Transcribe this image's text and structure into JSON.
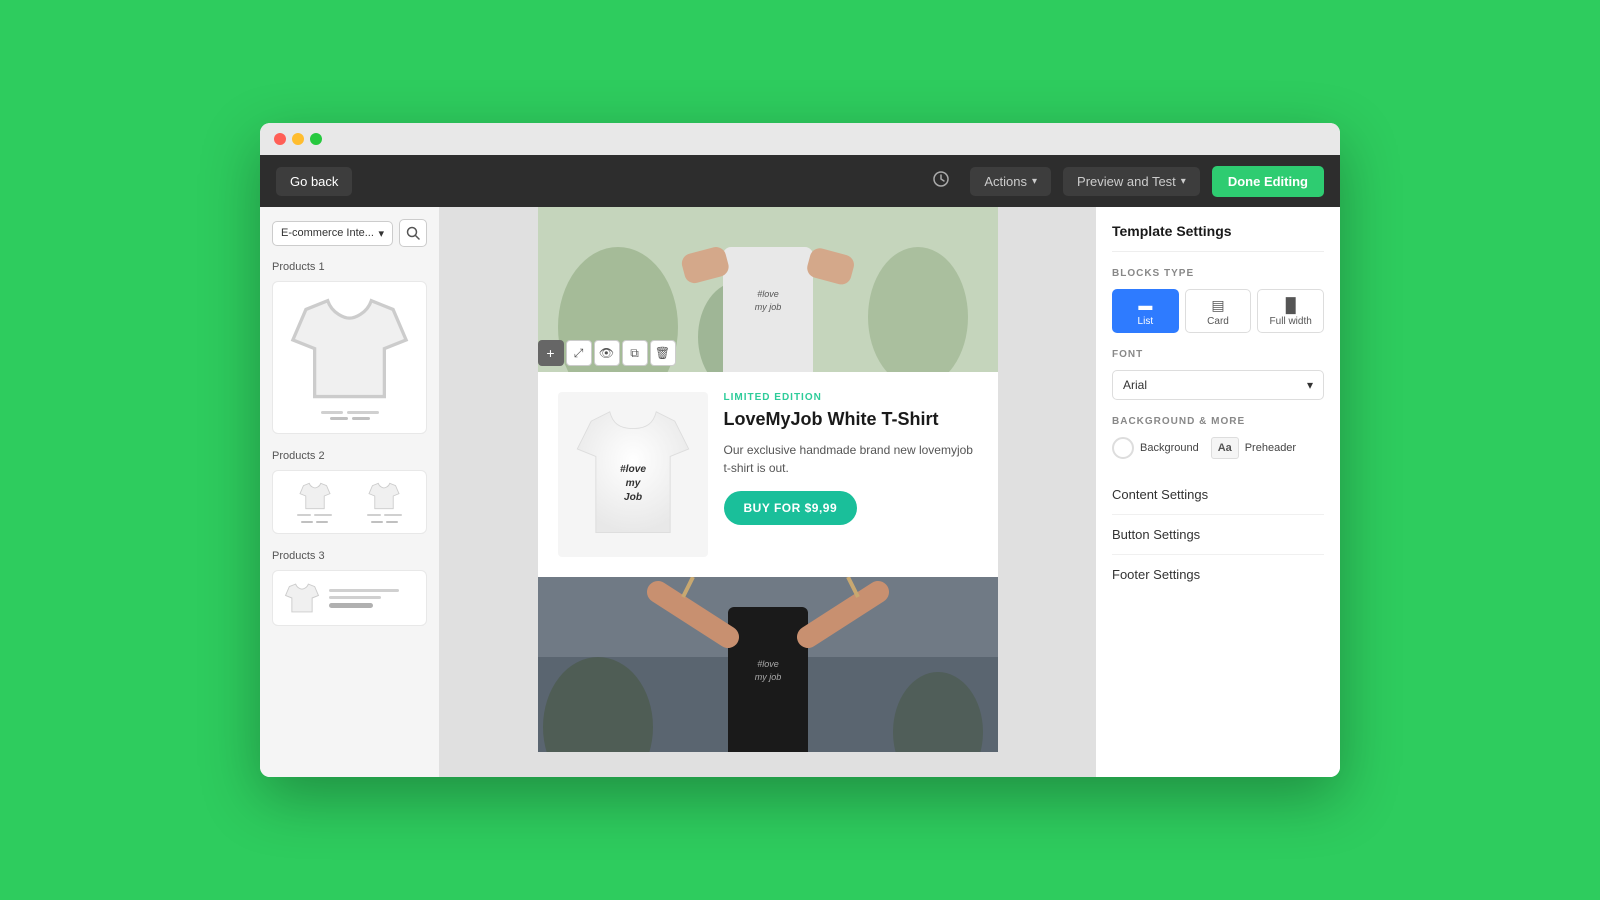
{
  "browser": {
    "dots": [
      "red",
      "yellow",
      "green"
    ]
  },
  "toolbar": {
    "go_back_label": "Go back",
    "history_icon": "↺",
    "actions_label": "Actions",
    "preview_label": "Preview and Test",
    "done_label": "Done Editing"
  },
  "left_sidebar": {
    "dropdown_value": "E-commerce Inte...",
    "search_placeholder": "Search",
    "sections": [
      {
        "label": "Products 1",
        "type": "single"
      },
      {
        "label": "Products 2",
        "type": "double"
      },
      {
        "label": "Products 3",
        "type": "horizontal"
      }
    ]
  },
  "canvas": {
    "product_badge": "LIMITED EDITION",
    "product_title": "LoveMyJob White T-Shirt",
    "product_description": "Our exclusive handmade brand new lovemyjob t-shirt is out.",
    "buy_button_label": "BUY FOR $9,99"
  },
  "right_panel": {
    "title": "Template Settings",
    "blocks_type_label": "BLOCKS TYPE",
    "blocks": [
      {
        "label": "List",
        "active": true
      },
      {
        "label": "Card",
        "active": false
      },
      {
        "label": "Full width",
        "active": false
      }
    ],
    "font_label": "FONT",
    "font_value": "Arial",
    "bg_label": "BACKGROUND & MORE",
    "background_label": "Background",
    "preheader_label": "Preheader",
    "settings": [
      {
        "label": "Content Settings"
      },
      {
        "label": "Button Settings"
      },
      {
        "label": "Footer Settings"
      }
    ]
  }
}
